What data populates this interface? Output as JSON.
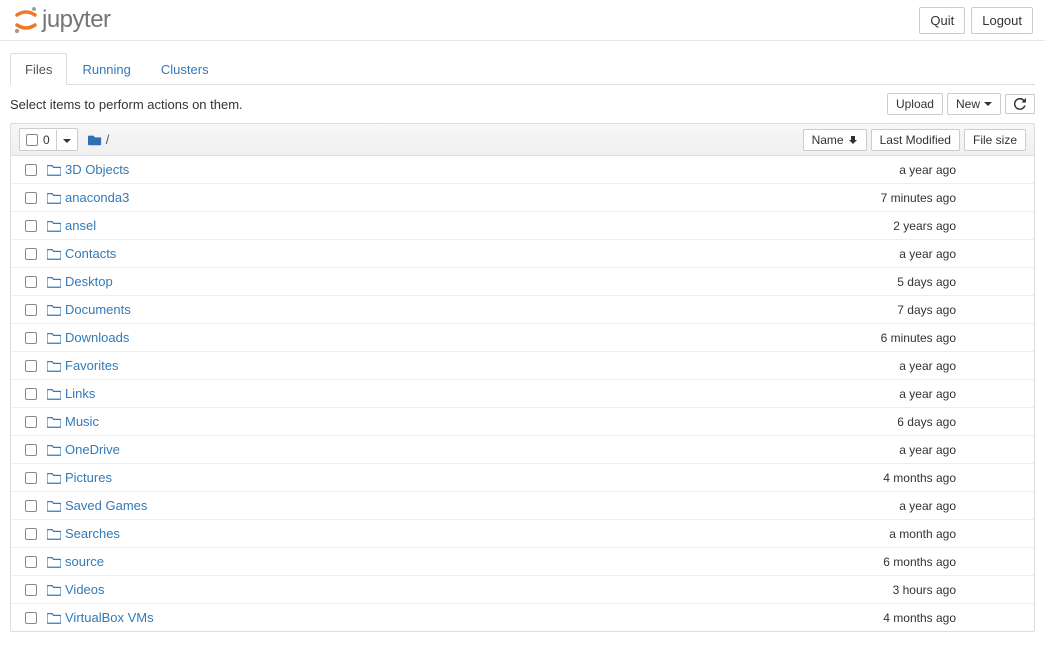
{
  "header": {
    "logo_text": "jupyter",
    "quit": "Quit",
    "logout": "Logout"
  },
  "tabs": {
    "files": "Files",
    "running": "Running",
    "clusters": "Clusters"
  },
  "hint": "Select items to perform actions on them.",
  "actions": {
    "upload": "Upload",
    "new": "New"
  },
  "listHeader": {
    "count": "0",
    "name": "Name",
    "lastModified": "Last Modified",
    "fileSize": "File size"
  },
  "breadcrumb": {
    "root": "/"
  },
  "files": [
    {
      "name": "3D Objects",
      "modified": "a year ago",
      "size": ""
    },
    {
      "name": "anaconda3",
      "modified": "7 minutes ago",
      "size": ""
    },
    {
      "name": "ansel",
      "modified": "2 years ago",
      "size": ""
    },
    {
      "name": "Contacts",
      "modified": "a year ago",
      "size": ""
    },
    {
      "name": "Desktop",
      "modified": "5 days ago",
      "size": ""
    },
    {
      "name": "Documents",
      "modified": "7 days ago",
      "size": ""
    },
    {
      "name": "Downloads",
      "modified": "6 minutes ago",
      "size": ""
    },
    {
      "name": "Favorites",
      "modified": "a year ago",
      "size": ""
    },
    {
      "name": "Links",
      "modified": "a year ago",
      "size": ""
    },
    {
      "name": "Music",
      "modified": "6 days ago",
      "size": ""
    },
    {
      "name": "OneDrive",
      "modified": "a year ago",
      "size": ""
    },
    {
      "name": "Pictures",
      "modified": "4 months ago",
      "size": ""
    },
    {
      "name": "Saved Games",
      "modified": "a year ago",
      "size": ""
    },
    {
      "name": "Searches",
      "modified": "a month ago",
      "size": ""
    },
    {
      "name": "source",
      "modified": "6 months ago",
      "size": ""
    },
    {
      "name": "Videos",
      "modified": "3 hours ago",
      "size": ""
    },
    {
      "name": "VirtualBox VMs",
      "modified": "4 months ago",
      "size": ""
    }
  ]
}
